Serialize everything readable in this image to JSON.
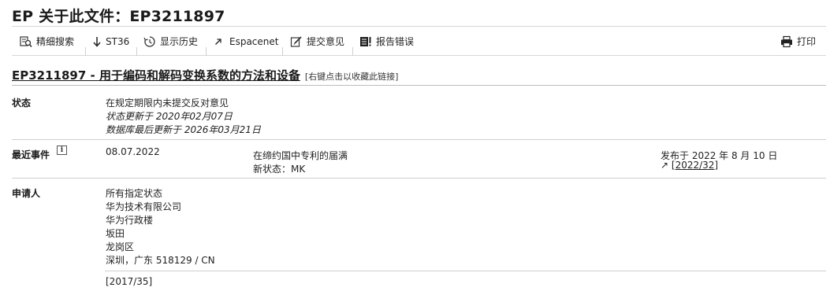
{
  "page": {
    "title": "EP 关于此文件：EP3211897"
  },
  "toolbar": {
    "refine_search": "精细搜索",
    "st36": "ST36",
    "history": "显示历史",
    "espacenet": "Espacenet",
    "submit_observations": "提交意见",
    "report_error": "报告错误",
    "print": "打印"
  },
  "document": {
    "title": "EP3211897 - 用于编码和解码变换系数的方法和设备",
    "bookmark_hint": "[右键点击以收藏此链接]"
  },
  "status": {
    "label": "状态",
    "text": "在规定期限内未提交反对意见",
    "updated": "状态更新于 2020年02月07日",
    "db_updated": "数据库最后更新于 2026年03月21日"
  },
  "recent_event": {
    "label": "最近事件",
    "info_icon": "i",
    "date": "08.07.2022",
    "description": "在缔约国中专利的届满",
    "new_status": "新状态：MK",
    "published": "发布于 2022 年 8 月 10 日",
    "bulletin_arrow": "↗",
    "bulletin_link": "[2022/32]"
  },
  "applicant": {
    "label": "申请人",
    "designation": "所有指定状态",
    "name": "华为技术有限公司",
    "address1": "华为行政楼",
    "address2": "坂田",
    "address3": "龙岗区",
    "address4": "深圳，广东 518129 / CN",
    "bulletin": "[2017/35]"
  }
}
